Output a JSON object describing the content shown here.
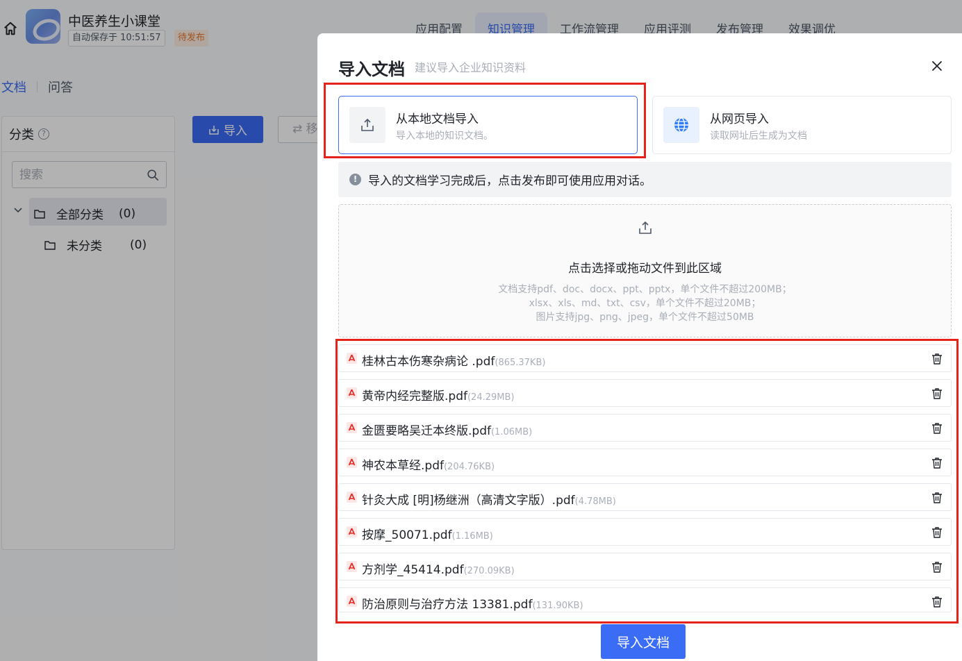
{
  "app": {
    "title": "中医养生小课堂",
    "autosave": "自动保存于 10:51:57",
    "status": "待发布"
  },
  "topnav": {
    "tabs": [
      {
        "label": "应用配置",
        "active": false
      },
      {
        "label": "知识管理",
        "active": true
      },
      {
        "label": "工作流管理",
        "active": false
      },
      {
        "label": "应用评测",
        "active": false
      },
      {
        "label": "发布管理",
        "active": false
      },
      {
        "label": "效果调优",
        "active": false
      }
    ]
  },
  "subtabs": {
    "docs": "文档",
    "qa": "问答"
  },
  "category": {
    "title": "分类",
    "help": "?",
    "search_placeholder": "搜索",
    "items": [
      {
        "label": "全部分类",
        "count": "(0)"
      },
      {
        "label": "未分类",
        "count": "(0)"
      }
    ]
  },
  "actions": {
    "import_label": "导入",
    "move_label": "移"
  },
  "modal": {
    "title": "导入文档",
    "subtitle": "建议导入企业知识资料",
    "sources": [
      {
        "name": "从本地文档导入",
        "desc": "导入本地的知识文档。",
        "selected": true,
        "icon": "upload-icon"
      },
      {
        "name": "从网页导入",
        "desc": "读取网址后生成为文档",
        "selected": false,
        "icon": "globe-icon"
      }
    ],
    "notice": "导入的文档学习完成后，点击发布即可使用应用对话。",
    "dropzone": {
      "main": "点击选择或拖动文件到此区域",
      "line1": "文档支持pdf、doc、docx、ppt、pptx，单个文件不超过200MB；",
      "line2": "xlsx、xls、md、txt、csv，单个文件不超过20MB；",
      "line3": "图片支持jpg、png、jpeg，单个文件不超过50MB"
    },
    "files": [
      {
        "name": "桂林古本伤寒杂病论 .pdf",
        "size": "(865.37KB)"
      },
      {
        "name": "黄帝内经完整版.pdf",
        "size": "(24.29MB)"
      },
      {
        "name": "金匮要略吴迁本终版.pdf",
        "size": "(1.06MB)"
      },
      {
        "name": "神农本草经.pdf",
        "size": "(204.76KB)"
      },
      {
        "name": "针灸大成 [明]杨继洲（高清文字版）.pdf",
        "size": "(4.78MB)"
      },
      {
        "name": "按摩_50071.pdf",
        "size": "(1.16MB)"
      },
      {
        "name": "方剂学_45414.pdf",
        "size": "(270.09KB)"
      },
      {
        "name": "防治原则与治疗方法 13381.pdf",
        "size": "(131.90KB)"
      }
    ],
    "submit_label": "导入文档"
  },
  "colors": {
    "primary": "#3a6cf5",
    "highlight": "#e5231b",
    "pending": "#e8762d"
  }
}
